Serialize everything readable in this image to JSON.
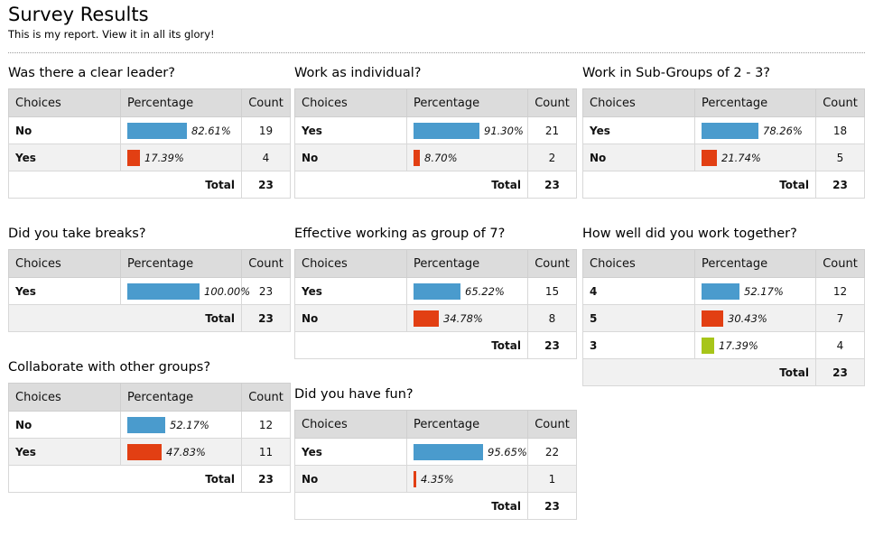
{
  "page": {
    "title": "Survey Results",
    "subtitle": "This is my report. View it in all its glory!"
  },
  "headers": {
    "choices": "Choices",
    "percentage": "Percentage",
    "count": "Count",
    "total": "Total"
  },
  "colors": {
    "blue": "#4a9bcd",
    "red": "#e23f13",
    "green": "#a7c519"
  },
  "questions": [
    {
      "id": "q1",
      "title": "Was there a clear leader?",
      "total": "23",
      "rows": [
        {
          "choice": "No",
          "percentage": "82.61%",
          "value": 82.61,
          "count": "19",
          "color": "blue"
        },
        {
          "choice": "Yes",
          "percentage": "17.39%",
          "value": 17.39,
          "count": "4",
          "color": "red"
        }
      ]
    },
    {
      "id": "q2",
      "title": "Work as individual?",
      "total": "23",
      "rows": [
        {
          "choice": "Yes",
          "percentage": "91.30%",
          "value": 91.3,
          "count": "21",
          "color": "blue"
        },
        {
          "choice": "No",
          "percentage": "8.70%",
          "value": 8.7,
          "count": "2",
          "color": "red"
        }
      ]
    },
    {
      "id": "q3",
      "title": "Work in Sub-Groups of 2 - 3?",
      "total": "23",
      "rows": [
        {
          "choice": "Yes",
          "percentage": "78.26%",
          "value": 78.26,
          "count": "18",
          "color": "blue"
        },
        {
          "choice": "No",
          "percentage": "21.74%",
          "value": 21.74,
          "count": "5",
          "color": "red"
        }
      ]
    },
    {
      "id": "q4",
      "title": "Did you take breaks?",
      "total": "23",
      "rows": [
        {
          "choice": "Yes",
          "percentage": "100.00%",
          "value": 100.0,
          "count": "23",
          "color": "blue"
        }
      ]
    },
    {
      "id": "q5",
      "title": "Effective working as group of 7?",
      "total": "23",
      "rows": [
        {
          "choice": "Yes",
          "percentage": "65.22%",
          "value": 65.22,
          "count": "15",
          "color": "blue"
        },
        {
          "choice": "No",
          "percentage": "34.78%",
          "value": 34.78,
          "count": "8",
          "color": "red"
        }
      ]
    },
    {
      "id": "q6",
      "title": "How well did you work together?",
      "total": "23",
      "rows": [
        {
          "choice": "4",
          "percentage": "52.17%",
          "value": 52.17,
          "count": "12",
          "color": "blue"
        },
        {
          "choice": "5",
          "percentage": "30.43%",
          "value": 30.43,
          "count": "7",
          "color": "red"
        },
        {
          "choice": "3",
          "percentage": "17.39%",
          "value": 17.39,
          "count": "4",
          "color": "green"
        }
      ]
    },
    {
      "id": "q7",
      "title": "Collaborate with other groups?",
      "total": "23",
      "rows": [
        {
          "choice": "No",
          "percentage": "52.17%",
          "value": 52.17,
          "count": "12",
          "color": "blue"
        },
        {
          "choice": "Yes",
          "percentage": "47.83%",
          "value": 47.83,
          "count": "11",
          "color": "red"
        }
      ]
    },
    {
      "id": "q8",
      "title": "Did you have fun?",
      "total": "23",
      "rows": [
        {
          "choice": "Yes",
          "percentage": "95.65%",
          "value": 95.65,
          "count": "22",
          "color": "blue"
        },
        {
          "choice": "No",
          "percentage": "4.35%",
          "value": 4.35,
          "count": "1",
          "color": "red"
        }
      ]
    }
  ]
}
